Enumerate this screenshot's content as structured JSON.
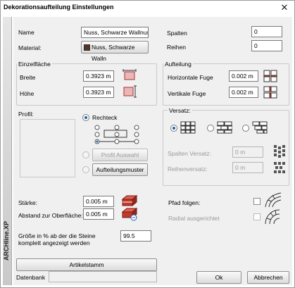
{
  "window": {
    "title": "Dekorationsaufteilung Einstellungen",
    "close_glyph": "✕"
  },
  "brand": "ARCHline.XP",
  "name": {
    "label": "Name",
    "value": "Nuss, Schwarze Wallnuss"
  },
  "material": {
    "label": "Material:",
    "value": "Nuss, Schwarze Walln",
    "swatch_color": "#5a3220"
  },
  "spalten": {
    "label": "Spalten",
    "value": "0"
  },
  "reihen": {
    "label": "Reihen",
    "value": "0"
  },
  "einzelflaeche": {
    "title": "Einzelfläche",
    "breite": {
      "label": "Breite",
      "value": "0.3923 m"
    },
    "hoehe": {
      "label": "Höhe",
      "value": "0.3923 m"
    }
  },
  "aufteilung": {
    "title": "Aufteilung",
    "horizontale_fuge": {
      "label": "Horizontale Fuge",
      "value": "0.002 m"
    },
    "vertikale_fuge": {
      "label": "Vertikale Fuge",
      "value": "0.002 m"
    }
  },
  "profil": {
    "label": "Profil:",
    "rechteck_label": "Rechteck",
    "profil_auswahl_label": "Profil Auswahl",
    "aufteilungsmuster_label": "Aufteilungsmuster"
  },
  "versatz": {
    "title": "Versatz:",
    "spalten_versatz": {
      "label": "Spalten Versatz:",
      "value": "0 m"
    },
    "reihen_versatz": {
      "label": "Reihenversatz:",
      "value": "0 m"
    }
  },
  "staerke": {
    "label": "Stärke:",
    "value": "0.005 m"
  },
  "abstand": {
    "label": "Abstand zur Oberfläche:",
    "value": "0.005 m"
  },
  "pfad_folgen": {
    "label": "Pfad folgen:"
  },
  "radial": {
    "label": "Radial ausgerichtet"
  },
  "groesse": {
    "label": "Größe in % ab der die Steine komplett angezeigt werden",
    "value": "99.5"
  },
  "artikelstamm_label": "Artikelstamm",
  "datenbank": {
    "label": "Datenbank",
    "value": ""
  },
  "ok_label": "Ok",
  "cancel_label": "Abbrechen",
  "colors": {
    "brick_red": "#c0392b",
    "accent_blue": "#1e5fb4"
  }
}
